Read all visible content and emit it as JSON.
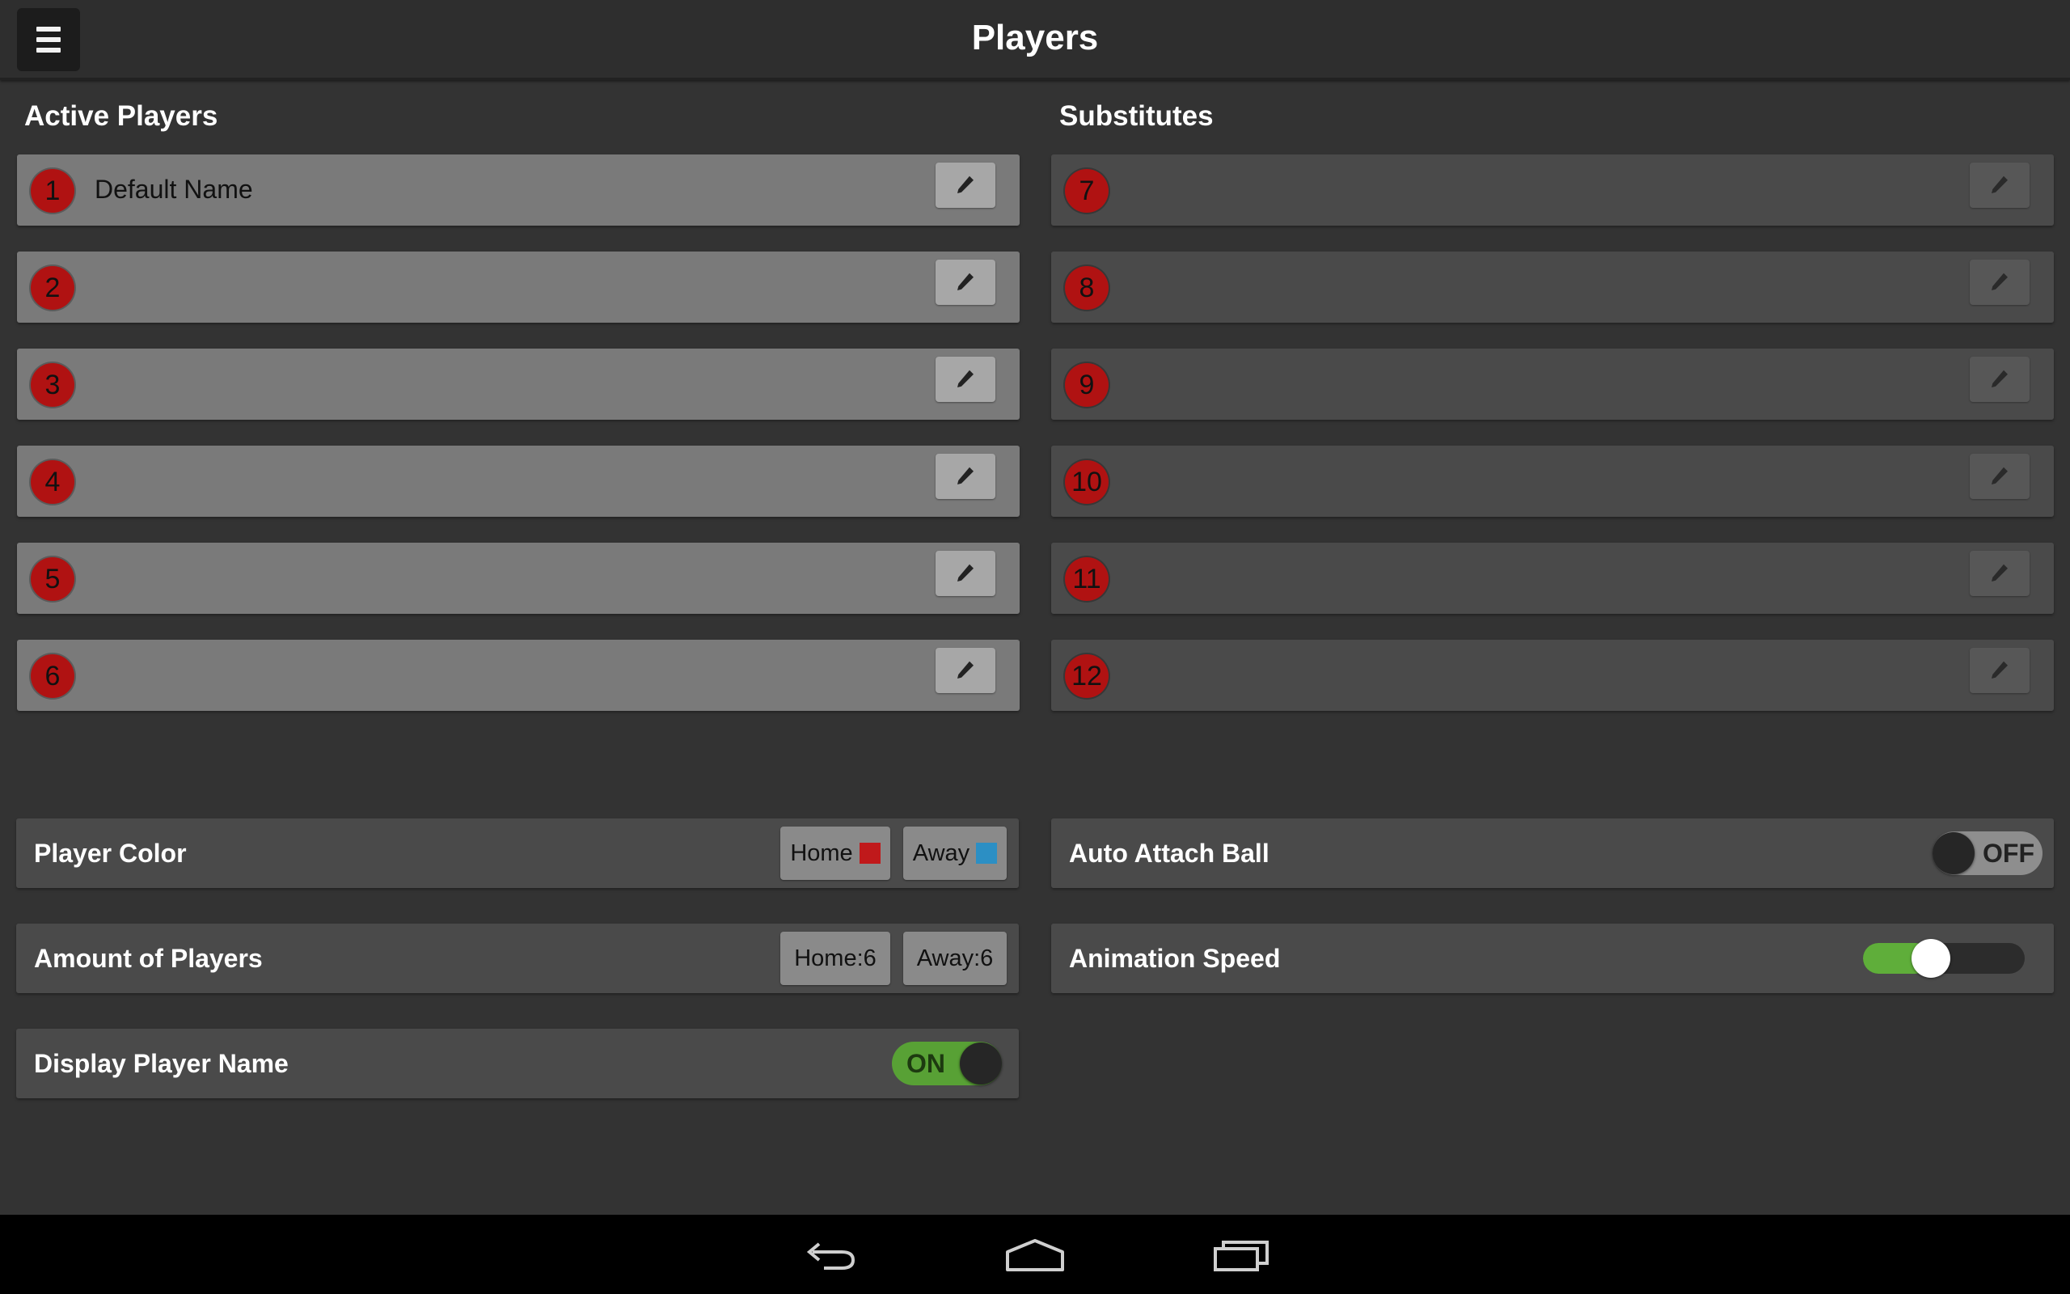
{
  "header": {
    "title": "Players",
    "menu_icon": "hamburger-menu-icon"
  },
  "active": {
    "title": "Active Players",
    "players": [
      {
        "number": "1",
        "name": "Default Name"
      },
      {
        "number": "2",
        "name": ""
      },
      {
        "number": "3",
        "name": ""
      },
      {
        "number": "4",
        "name": ""
      },
      {
        "number": "5",
        "name": ""
      },
      {
        "number": "6",
        "name": ""
      }
    ]
  },
  "subs": {
    "title": "Substitutes",
    "players": [
      {
        "number": "7",
        "name": ""
      },
      {
        "number": "8",
        "name": ""
      },
      {
        "number": "9",
        "name": ""
      },
      {
        "number": "10",
        "name": ""
      },
      {
        "number": "11",
        "name": ""
      },
      {
        "number": "12",
        "name": ""
      }
    ]
  },
  "settings": {
    "player_color": {
      "label": "Player Color",
      "home_label": "Home",
      "home_color": "#c0191b",
      "away_label": "Away",
      "away_color": "#2c8fc4"
    },
    "amount_of_players": {
      "label": "Amount of Players",
      "home_label": "Home:6",
      "away_label": "Away:6"
    },
    "display_player_name": {
      "label": "Display Player Name",
      "state": "ON"
    },
    "auto_attach_ball": {
      "label": "Auto Attach Ball",
      "state": "OFF"
    },
    "animation_speed": {
      "label": "Animation Speed",
      "value_fraction": 0.42
    }
  },
  "nav": {
    "back_icon": "back-arrow-icon",
    "home_icon": "home-icon",
    "recents_icon": "recent-apps-icon"
  }
}
